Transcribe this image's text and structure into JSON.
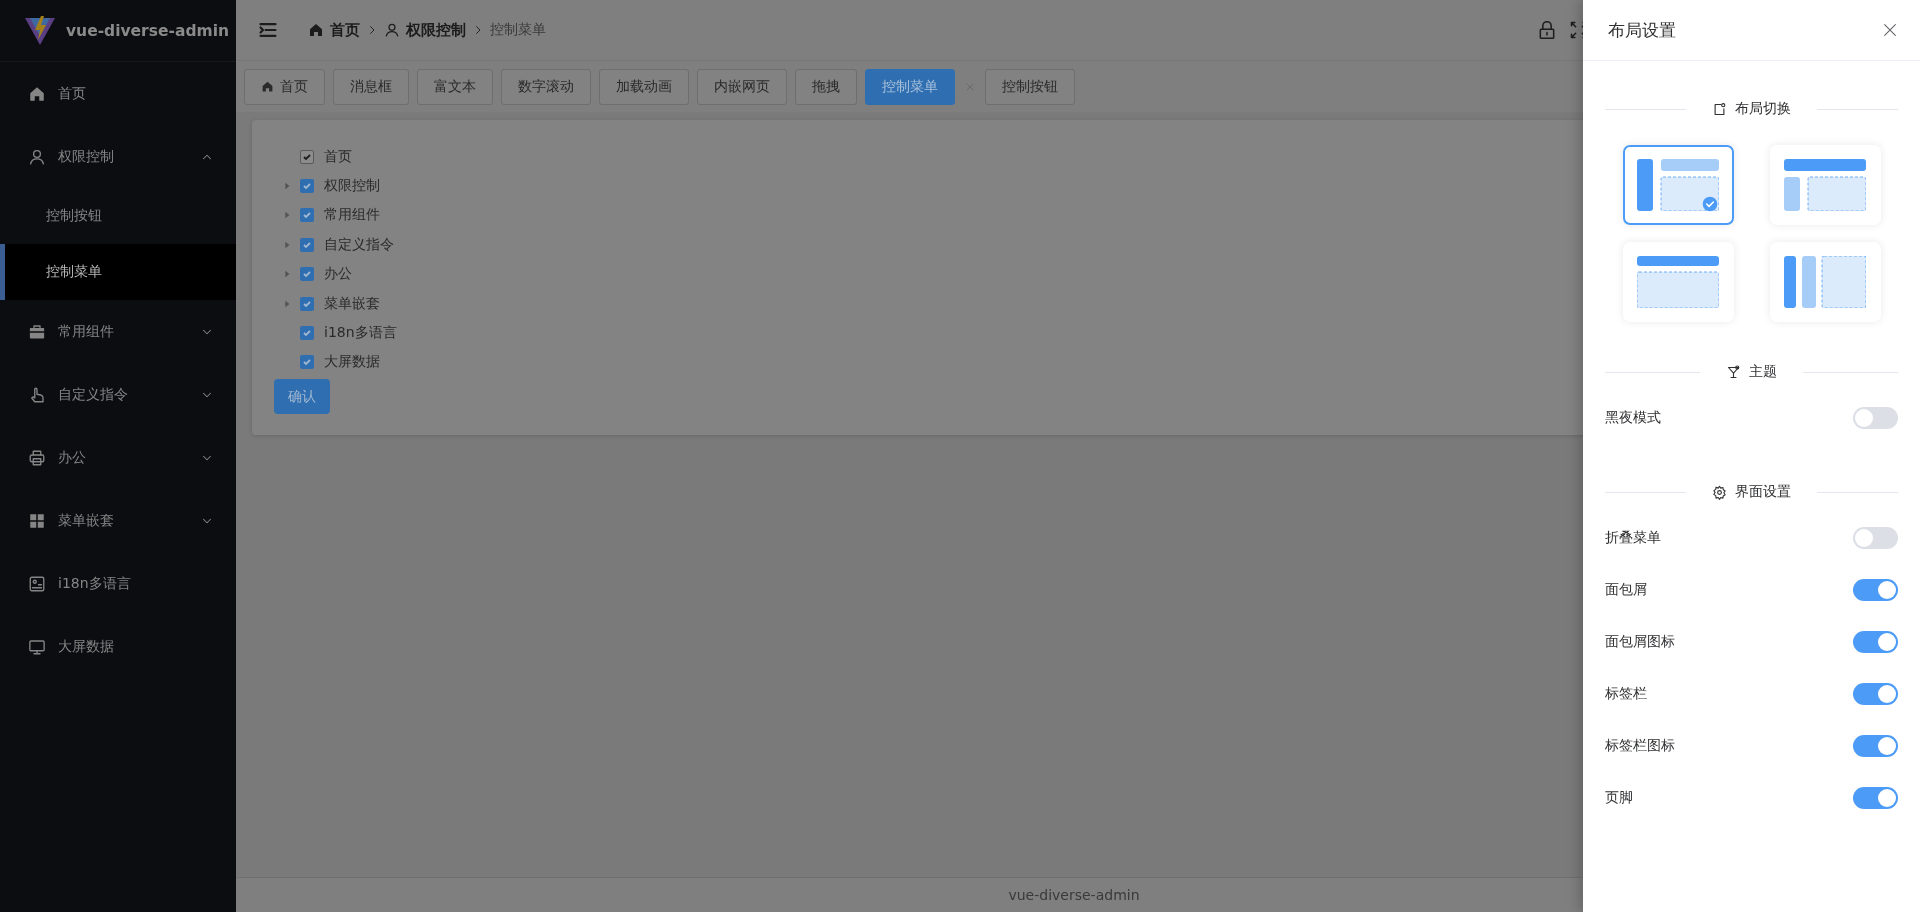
{
  "sidebar": {
    "logo_text": "vue-diverse-admin",
    "items": [
      {
        "label": "首页",
        "selected": false
      },
      {
        "label": "权限控制",
        "selected": false,
        "expanded": true,
        "children": [
          {
            "label": "控制按钮",
            "selected": false
          },
          {
            "label": "控制菜单",
            "selected": true
          }
        ]
      },
      {
        "label": "常用组件",
        "selected": false,
        "expanded": false
      },
      {
        "label": "自定义指令",
        "selected": false,
        "expanded": false
      },
      {
        "label": "办公",
        "selected": false,
        "expanded": false
      },
      {
        "label": "菜单嵌套",
        "selected": false,
        "expanded": false
      },
      {
        "label": "i18n多语言",
        "selected": false
      },
      {
        "label": "大屏数据",
        "selected": false
      }
    ]
  },
  "header": {
    "breadcrumb": [
      {
        "label": "首页",
        "current": false
      },
      {
        "label": "权限控制",
        "current": false
      },
      {
        "label": "控制菜单",
        "current": true
      }
    ]
  },
  "tabs": [
    {
      "label": "首页",
      "selected": false
    },
    {
      "label": "消息框",
      "selected": false
    },
    {
      "label": "富文本",
      "selected": false
    },
    {
      "label": "数字滚动",
      "selected": false
    },
    {
      "label": "加载动画",
      "selected": false
    },
    {
      "label": "内嵌网页",
      "selected": false
    },
    {
      "label": "拖拽",
      "selected": false
    },
    {
      "label": "控制菜单",
      "selected": true
    },
    {
      "label": "控制按钮",
      "selected": false
    }
  ],
  "tree": {
    "nodes": [
      {
        "label": "首页",
        "checked": true,
        "disabled": true
      },
      {
        "label": "权限控制",
        "checked": true,
        "disabled": false,
        "expanded": false
      },
      {
        "label": "常用组件",
        "checked": true,
        "disabled": false,
        "expanded": false
      },
      {
        "label": "自定义指令",
        "checked": true,
        "disabled": false,
        "expanded": false
      },
      {
        "label": "办公",
        "checked": true,
        "disabled": false,
        "expanded": false
      },
      {
        "label": "菜单嵌套",
        "checked": true,
        "disabled": false,
        "expanded": false
      },
      {
        "label": "i18n多语言",
        "checked": true,
        "disabled": false
      },
      {
        "label": "大屏数据",
        "checked": true,
        "disabled": false
      }
    ],
    "button": "确认"
  },
  "footer": "vue-diverse-admin",
  "drawer": {
    "title": "布局设置",
    "sections": [
      {
        "title": "布局切换",
        "kind": "layouts",
        "layouts": [
          {
            "kind": "vertical",
            "selected": true
          },
          {
            "kind": "classic",
            "selected": false
          },
          {
            "kind": "transverse",
            "selected": false
          },
          {
            "kind": "columns",
            "selected": false
          }
        ]
      },
      {
        "title": "主题",
        "kind": "switches",
        "items": [
          {
            "label": "黑夜模式",
            "on": false
          }
        ]
      },
      {
        "title": "界面设置",
        "kind": "switches",
        "items": [
          {
            "label": "折叠菜单",
            "on": false
          },
          {
            "label": "面包屑",
            "on": true
          },
          {
            "label": "面包屑图标",
            "on": true
          },
          {
            "label": "标签栏",
            "on": true
          },
          {
            "label": "标签栏图标",
            "on": true
          },
          {
            "label": "页脚",
            "on": true
          }
        ]
      }
    ]
  }
}
